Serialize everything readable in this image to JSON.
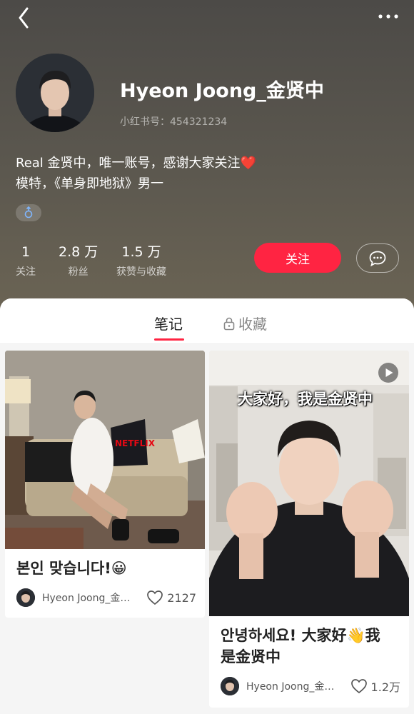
{
  "profile": {
    "nickname": "Hyeon Joong_金贤中",
    "red_id": "小红书号：454321234",
    "bio_line1": "Real 金贤中，唯一账号，感谢大家关注❤️",
    "bio_line2": "模特，《单身即地狱》男一",
    "gender_icon": "male-icon"
  },
  "stats": [
    {
      "value": "1",
      "label": "关注"
    },
    {
      "value": "2.8 万",
      "label": "粉丝"
    },
    {
      "value": "1.5 万",
      "label": "获赞与收藏"
    }
  ],
  "actions": {
    "follow_label": "关注",
    "chat_icon": "chat-bubble-icon"
  },
  "tabs": {
    "notes": "笔记",
    "collections": "收藏"
  },
  "notes": [
    {
      "title": "본인 맞습니다!😀",
      "author": "Hyeon Joong_金…",
      "likes": "2127"
    },
    {
      "title_line1": "안녕하세요! 大家好👋我",
      "title_line2": "是金贤中",
      "overlay": "大家好，我是金贤中",
      "author": "Hyeon Joong_金…",
      "likes": "1.2万"
    }
  ],
  "colors": {
    "accent": "#ff2442",
    "header_bg": "#55524c"
  }
}
